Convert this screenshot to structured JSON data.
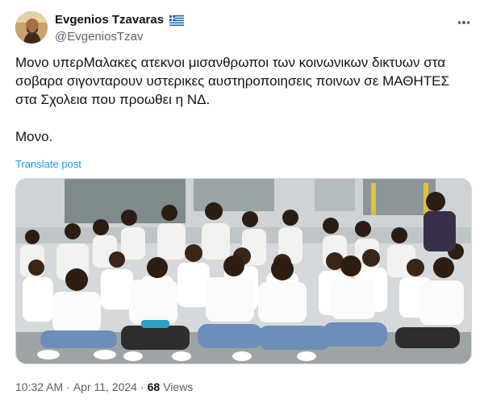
{
  "author": {
    "display_name": "Evgenios Tzavaras",
    "handle": "@EvgeniosTzav",
    "flag_icon": "greek-flag-icon",
    "avatar_icon": "profile-avatar"
  },
  "tweet": {
    "text": "Μονο υπερΜαλακες ατεκνοι μισανθρωποι των κοινωνικων δικτυων στα\nσοβαρα σιγονταρουν υστερικες αυστηροποιησεις ποινων σε ΜΑΘΗΤΕΣ\nστα Σχολεια που προωθει η ΝΔ.\n\nΜονο.",
    "translate_label": "Translate post",
    "media_description_icon": "photo-students-sitting"
  },
  "meta": {
    "time": "10:32 AM",
    "separator": "·",
    "date": "Apr 11, 2024",
    "views_count": "68",
    "views_label": "Views"
  },
  "colors": {
    "link": "#1d9bf0",
    "secondary_text": "#536471",
    "primary_text": "#0f1419"
  }
}
